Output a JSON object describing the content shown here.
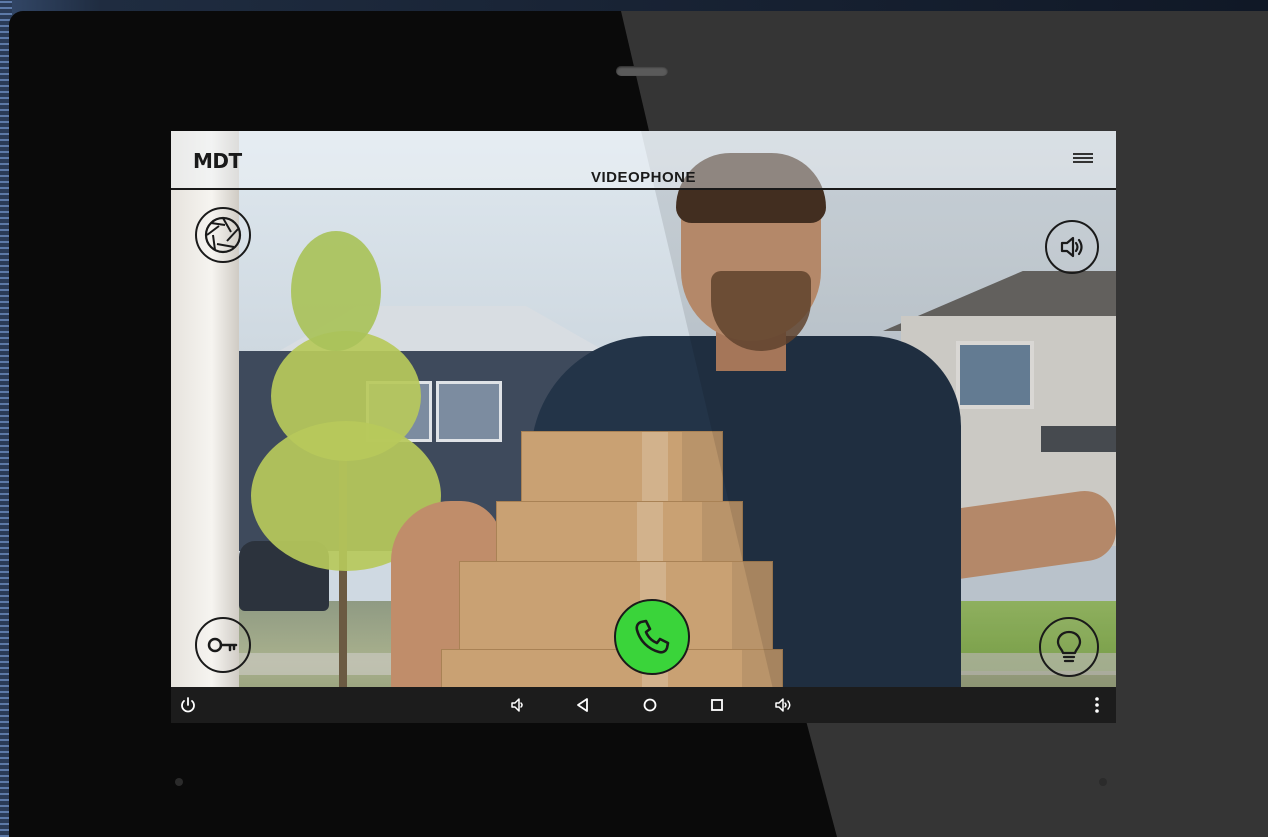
{
  "header": {
    "logo": "MDT",
    "title": "VIDEOPHONE"
  },
  "icons": {
    "menu": "menu-icon",
    "shutter": "camera-shutter-icon",
    "speaker": "speaker-icon",
    "key": "key-icon",
    "light": "lightbulb-icon",
    "call": "phone-icon"
  },
  "nav": {
    "power": "power-icon",
    "volume_down": "volume-down-icon",
    "back": "back-triangle-icon",
    "home": "home-circle-icon",
    "recents": "recents-square-icon",
    "volume_up": "volume-up-icon",
    "more": "more-vertical-icon"
  },
  "colors": {
    "call_green": "#3ad43a",
    "nav_bar": "#1c1c1c",
    "icon_stroke": "#1a1a1a",
    "bezel": "#0a0a0a"
  }
}
